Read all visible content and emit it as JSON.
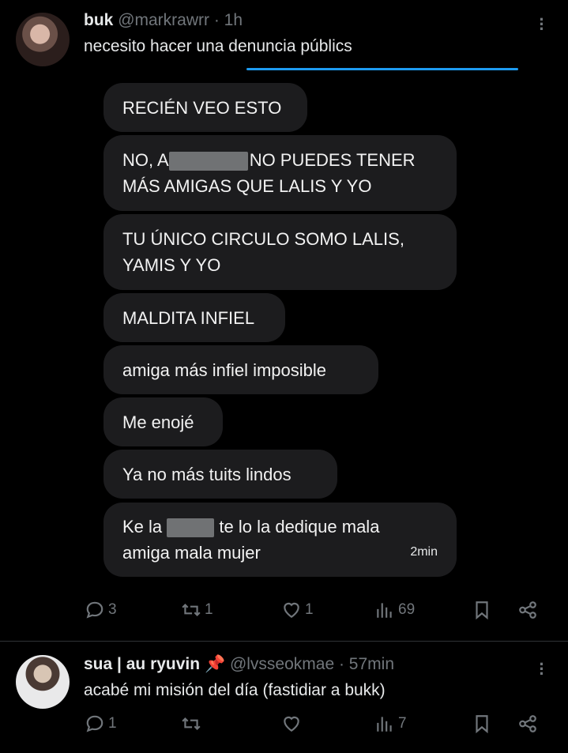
{
  "post1": {
    "name": "buk",
    "handle": "@markrawrr",
    "time": "· 1h",
    "text": "necesito hacer una denuncia públics",
    "messages": [
      {
        "line1": "RECIÉN VEO ESTO"
      },
      {
        "line1a": "NO, A",
        "line1b": "NO PUEDES TENER",
        "line2": "MÁS AMIGAS QUE LALIS Y YO"
      },
      {
        "line1": "TU ÚNICO CIRCULO SOMO LALIS,",
        "line2": "YAMIS Y YO"
      },
      {
        "line1": "MALDITA INFIEL"
      },
      {
        "line1": "amiga más infiel imposible"
      },
      {
        "line1": "Me enojé"
      },
      {
        "line1": "Ya no más tuits lindos"
      },
      {
        "line1a": "Ke la",
        "line1b": "te lo la dedique mala",
        "line2": "amiga mala mujer",
        "time": "2min"
      }
    ],
    "replies": "3",
    "reposts": "1",
    "likes": "1",
    "views": "69"
  },
  "post2": {
    "name": "sua | au ryuvin",
    "pin": "📌",
    "handle": "@lvsseokmae",
    "time": "· 57min",
    "text": "acabé mi misión del día (fastidiar a bukk)",
    "replies": "1",
    "reposts": "",
    "likes": "",
    "views": "7"
  },
  "icons": {
    "more": "more-vertical-icon",
    "reply": "reply-icon",
    "repost": "repost-icon",
    "like": "heart-icon",
    "views": "views-icon",
    "bookmark": "bookmark-icon",
    "share": "share-icon"
  },
  "colors": {
    "background": "#000000",
    "accent": "#1d9bf0",
    "muted": "#71767b",
    "bubble": "#1c1c1e"
  }
}
